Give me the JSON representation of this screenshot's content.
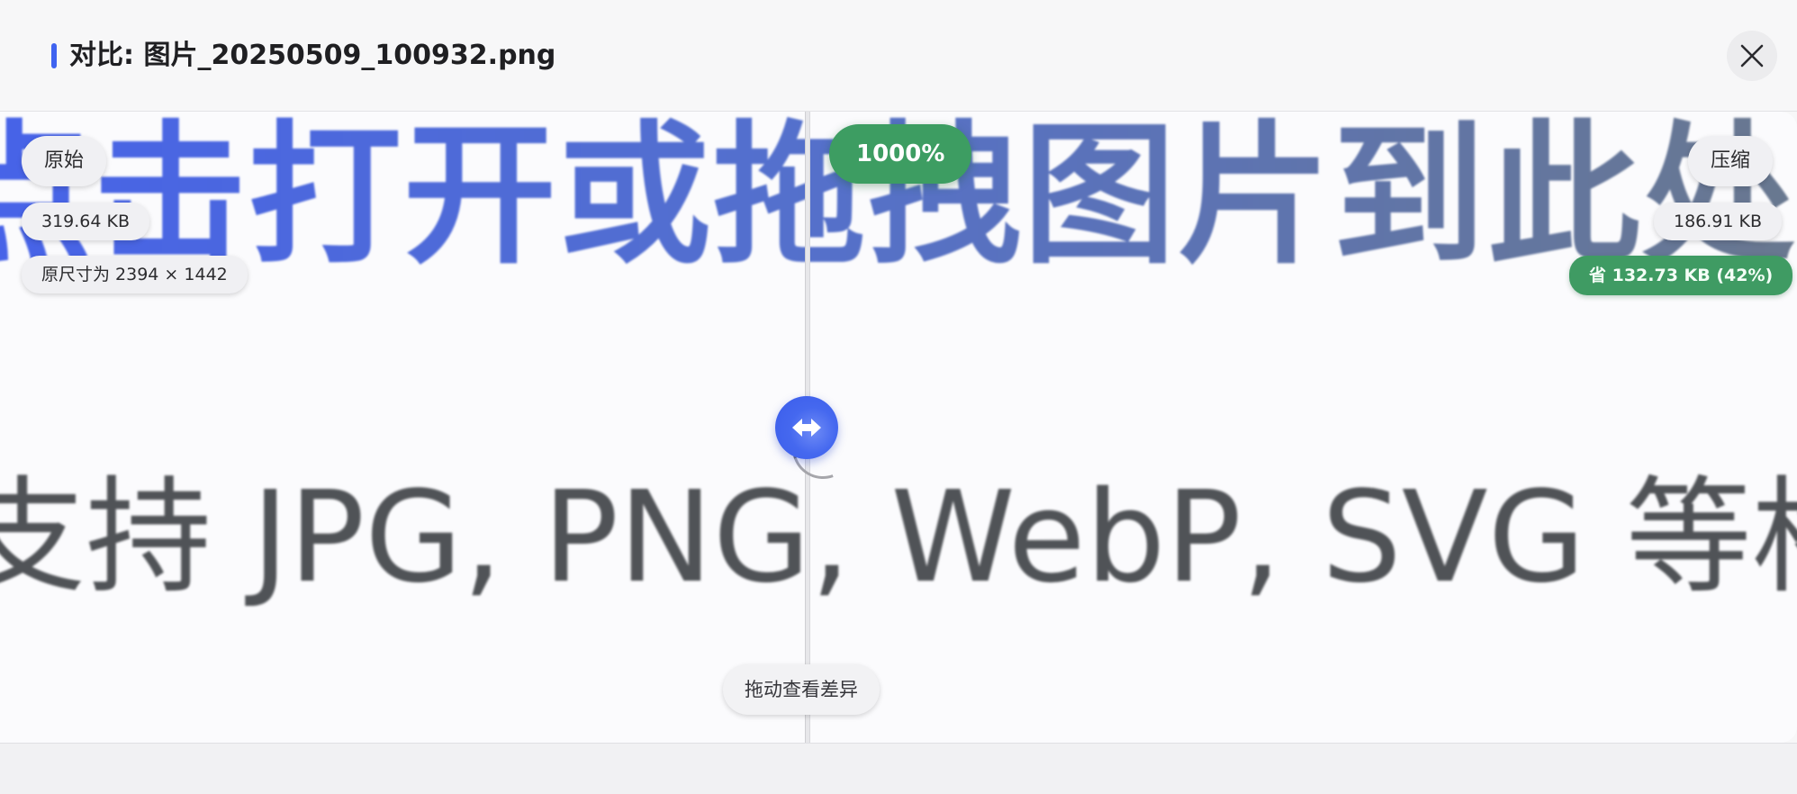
{
  "header": {
    "title": "对比: 图片_20250509_100932.png",
    "close_icon": "close-icon"
  },
  "preview": {
    "line1": "点击打开或拖拽图片到此处",
    "line2": "支持 JPG, PNG, WebP, SVG 等格式"
  },
  "original": {
    "label": "原始",
    "size": "319.64 KB",
    "dimensions": "原尺寸为 2394 × 1442"
  },
  "compressed": {
    "label": "压缩",
    "size": "186.91 KB",
    "saved": "省 132.73 KB (42%)"
  },
  "zoom": "1000%",
  "slider": {
    "hint": "拖动查看差异",
    "handle_icon": "drag-arrows-icon",
    "position_fraction": 0.45
  },
  "colors": {
    "accent": "#3f63f0",
    "success": "#3f9b63"
  }
}
